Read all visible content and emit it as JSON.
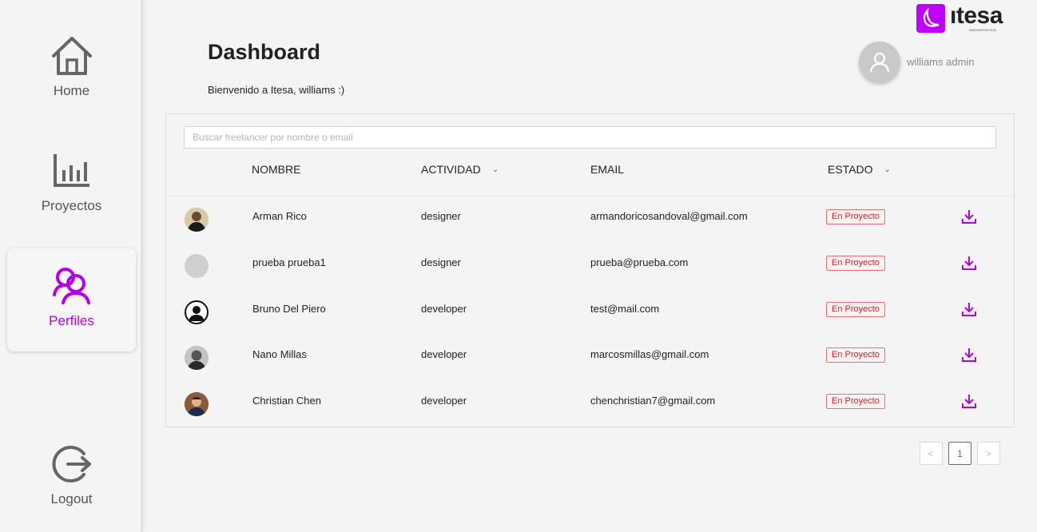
{
  "brand": {
    "name": "ıtesa",
    "tagline": "INNOVATION HUB",
    "accent": "#c000ff"
  },
  "sidebar": {
    "items": [
      {
        "label": "Home",
        "icon": "home-icon",
        "active": false
      },
      {
        "label": "Proyectos",
        "icon": "bar-chart-icon",
        "active": false
      },
      {
        "label": "Perfiles",
        "icon": "users-icon",
        "active": true
      },
      {
        "label": "Logout",
        "icon": "logout-icon",
        "active": false
      }
    ]
  },
  "header": {
    "title": "Dashboard",
    "welcome": "Bienvenido a Itesa, williams :)",
    "user_name": "williams admin"
  },
  "search": {
    "placeholder": "Buscar freelancer por nombre o email",
    "value": ""
  },
  "table": {
    "columns": [
      "NOMBRE",
      "ACTIVIDAD",
      "EMAIL",
      "ESTADO"
    ],
    "rows": [
      {
        "name": "Arman Rico",
        "activity": "designer",
        "email": "armandoricosandoval@gmail.com",
        "status": "En Proyecto",
        "avatar": "photo"
      },
      {
        "name": "prueba prueba1",
        "activity": "designer",
        "email": "prueba@prueba.com",
        "status": "En Proyecto",
        "avatar": "blank"
      },
      {
        "name": "Bruno Del Piero",
        "activity": "developer",
        "email": "test@mail.com",
        "status": "En Proyecto",
        "avatar": "default-user"
      },
      {
        "name": "Nano Millas",
        "activity": "developer",
        "email": "marcosmillas@gmail.com",
        "status": "En Proyecto",
        "avatar": "photo"
      },
      {
        "name": "Christian Chen",
        "activity": "developer",
        "email": "chenchristian7@gmail.com",
        "status": "En Proyecto",
        "avatar": "photo"
      }
    ]
  },
  "pagination": {
    "prev": "<",
    "current": "1",
    "next": ">"
  }
}
